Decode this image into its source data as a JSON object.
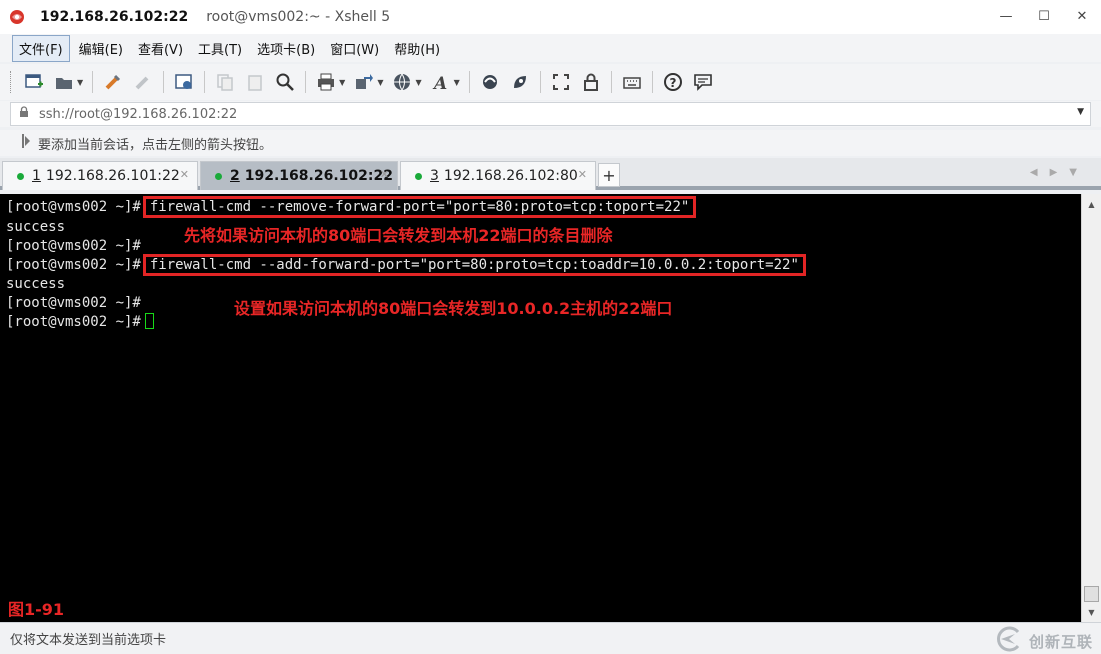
{
  "window": {
    "host_title": "192.168.26.102:22",
    "subtitle": "root@vms002:~ - Xshell 5",
    "minimize": "—",
    "maximize": "☐",
    "close": "✕"
  },
  "menu": {
    "items": [
      "文件(F)",
      "编辑(E)",
      "查看(V)",
      "工具(T)",
      "选项卡(B)",
      "窗口(W)",
      "帮助(H)"
    ]
  },
  "toolbar": {
    "icons": [
      "new-session-icon",
      "open-folder-icon",
      "connect-icon",
      "disconnect-icon",
      "properties-icon",
      "copy-icon",
      "paste-icon",
      "find-icon",
      "print-icon",
      "transfer-icon",
      "globe-icon",
      "font-icon",
      "xftp-icon",
      "xmanager-icon",
      "fullscreen-icon",
      "lock-icon",
      "keyboard-icon",
      "help-icon",
      "chat-icon"
    ]
  },
  "address": {
    "value": "ssh://root@192.168.26.102:22"
  },
  "hint": {
    "text": "要添加当前会话，点击左侧的箭头按钮。"
  },
  "tabs": [
    {
      "num": "1",
      "label": "192.168.26.101:22",
      "status_color": "#1aaa3a",
      "active": false
    },
    {
      "num": "2",
      "label": "192.168.26.102:22",
      "status_color": "#1aaa3a",
      "active": true
    },
    {
      "num": "3",
      "label": "192.168.26.102:80",
      "status_color": "#1aaa3a",
      "active": false
    }
  ],
  "terminal": {
    "prompt": "[root@vms002 ~]#",
    "lines": [
      {
        "prompt": "[root@vms002 ~]#",
        "command": "firewall-cmd --remove-forward-port=\"port=80:proto=tcp:toport=22\"",
        "highlighted": true
      },
      {
        "output": "success"
      },
      {
        "prompt": "[root@vms002 ~]#",
        "command": ""
      },
      {
        "prompt": "[root@vms002 ~]#",
        "command": "firewall-cmd --add-forward-port=\"port=80:proto=tcp:toaddr=10.0.0.2:toport=22\"",
        "highlighted": true
      },
      {
        "output": "success"
      },
      {
        "prompt": "[root@vms002 ~]#",
        "command": ""
      },
      {
        "prompt": "[root@vms002 ~]#",
        "command": "",
        "cursor": true
      }
    ],
    "annotations": [
      "先将如果访问本机的80端口会转发到本机22端口的条目删除",
      "设置如果访问本机的80端口会转发到10.0.0.2主机的22端口"
    ],
    "figure_label": "图1-91",
    "highlight_color": "#e22525",
    "cursor_color": "#18d818"
  },
  "status": {
    "text": "仅将文本发送到当前选项卡"
  },
  "watermark": {
    "text": "创新互联"
  }
}
